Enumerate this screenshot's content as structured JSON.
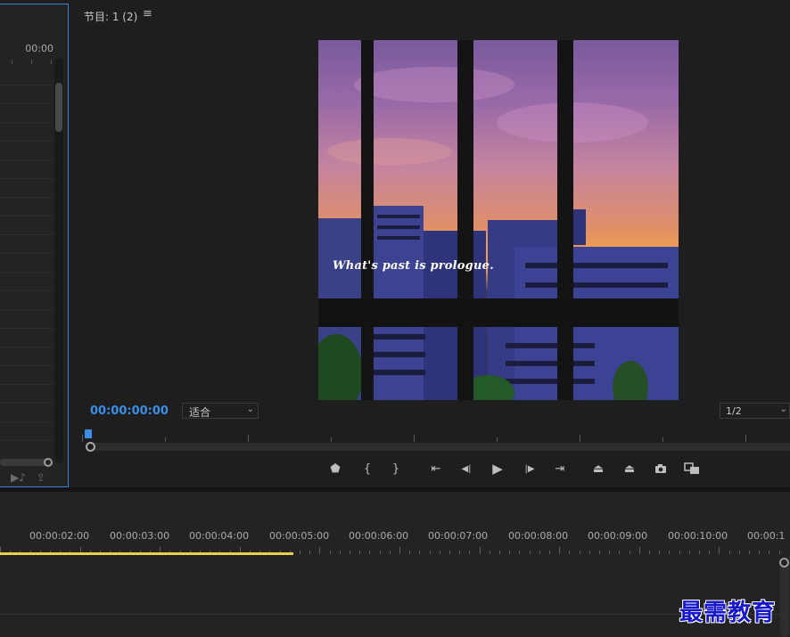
{
  "source_panel": {
    "timecode": "00:00"
  },
  "program_monitor": {
    "title": "节目: 1 (2)",
    "menu_icon": "≡",
    "timecode": "00:00:00:00",
    "fit": "适合",
    "resolution": "1/2",
    "video_caption": "What's past is prologue.",
    "transport": [
      {
        "name": "add-marker-button",
        "glyph": "⬟"
      },
      {
        "name": "mark-in-button",
        "glyph": "{"
      },
      {
        "name": "mark-out-button",
        "glyph": "}"
      },
      {
        "name": "go-to-in-button",
        "glyph": "⇤"
      },
      {
        "name": "step-back-button",
        "glyph": "◀|"
      },
      {
        "name": "play-button",
        "glyph": "▶"
      },
      {
        "name": "step-forward-button",
        "glyph": "|▶"
      },
      {
        "name": "go-to-out-button",
        "glyph": "⇥"
      },
      {
        "name": "lift-button",
        "glyph": "⏏"
      },
      {
        "name": "extract-button",
        "glyph": "⏏"
      },
      {
        "name": "export-frame-button",
        "glyph": "📷"
      },
      {
        "name": "comparison-view-button",
        "glyph": "▣"
      }
    ]
  },
  "timeline": {
    "labels": [
      "00:00:02:00",
      "00:00:03:00",
      "00:00:04:00",
      "00:00:05:00",
      "00:00:06:00",
      "00:00:07:00",
      "00:00:08:00",
      "00:00:09:00",
      "00:00:10:00",
      "00:00:1"
    ]
  },
  "watermark": "最需教育",
  "colors": {
    "accent": "#3a8ee6",
    "work_area": "#e6d24a",
    "panel_border": "#3b7fd6"
  }
}
